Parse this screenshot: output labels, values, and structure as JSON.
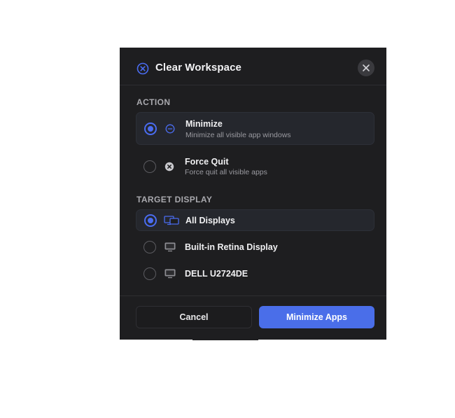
{
  "dialog": {
    "title": "Clear Workspace",
    "accent_color": "#4a6cf0",
    "header_icon": "circle-x-icon",
    "close_icon": "close-icon"
  },
  "action_section": {
    "label": "ACTION",
    "options": [
      {
        "title": "Minimize",
        "subtitle": "Minimize all visible app windows",
        "icon": "minus-circle-icon",
        "selected": true
      },
      {
        "title": "Force Quit",
        "subtitle": "Force quit all visible apps",
        "icon": "x-circle-filled-icon",
        "selected": false
      }
    ]
  },
  "target_section": {
    "label": "TARGET DISPLAY",
    "options": [
      {
        "title": "All Displays",
        "icon": "multiple-displays-icon",
        "selected": true
      },
      {
        "title": "Built-in Retina Display",
        "icon": "display-icon",
        "selected": false
      },
      {
        "title": "DELL U2724DE",
        "icon": "display-icon",
        "selected": false
      }
    ]
  },
  "footer": {
    "cancel_label": "Cancel",
    "primary_label": "Minimize Apps",
    "primary_color": "#4a6ee9"
  }
}
